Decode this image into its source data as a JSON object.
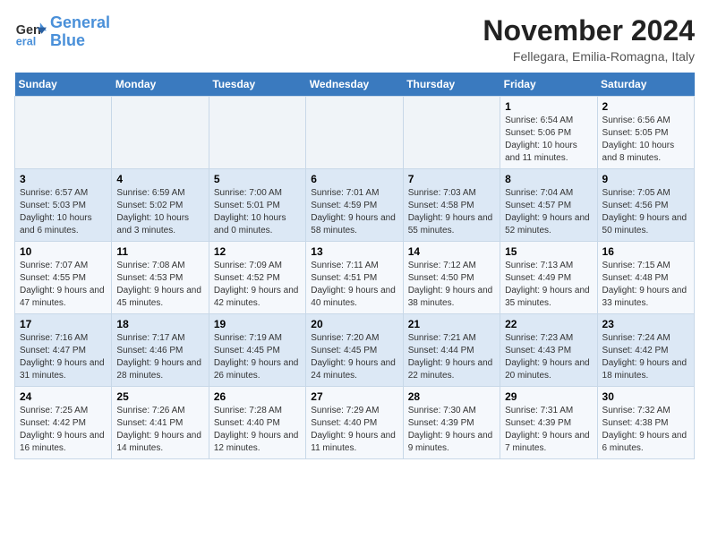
{
  "logo": {
    "line1": "General",
    "line2": "Blue"
  },
  "title": "November 2024",
  "location": "Fellegara, Emilia-Romagna, Italy",
  "weekdays": [
    "Sunday",
    "Monday",
    "Tuesday",
    "Wednesday",
    "Thursday",
    "Friday",
    "Saturday"
  ],
  "weeks": [
    [
      {
        "day": "",
        "info": ""
      },
      {
        "day": "",
        "info": ""
      },
      {
        "day": "",
        "info": ""
      },
      {
        "day": "",
        "info": ""
      },
      {
        "day": "",
        "info": ""
      },
      {
        "day": "1",
        "info": "Sunrise: 6:54 AM\nSunset: 5:06 PM\nDaylight: 10 hours and 11 minutes."
      },
      {
        "day": "2",
        "info": "Sunrise: 6:56 AM\nSunset: 5:05 PM\nDaylight: 10 hours and 8 minutes."
      }
    ],
    [
      {
        "day": "3",
        "info": "Sunrise: 6:57 AM\nSunset: 5:03 PM\nDaylight: 10 hours and 6 minutes."
      },
      {
        "day": "4",
        "info": "Sunrise: 6:59 AM\nSunset: 5:02 PM\nDaylight: 10 hours and 3 minutes."
      },
      {
        "day": "5",
        "info": "Sunrise: 7:00 AM\nSunset: 5:01 PM\nDaylight: 10 hours and 0 minutes."
      },
      {
        "day": "6",
        "info": "Sunrise: 7:01 AM\nSunset: 4:59 PM\nDaylight: 9 hours and 58 minutes."
      },
      {
        "day": "7",
        "info": "Sunrise: 7:03 AM\nSunset: 4:58 PM\nDaylight: 9 hours and 55 minutes."
      },
      {
        "day": "8",
        "info": "Sunrise: 7:04 AM\nSunset: 4:57 PM\nDaylight: 9 hours and 52 minutes."
      },
      {
        "day": "9",
        "info": "Sunrise: 7:05 AM\nSunset: 4:56 PM\nDaylight: 9 hours and 50 minutes."
      }
    ],
    [
      {
        "day": "10",
        "info": "Sunrise: 7:07 AM\nSunset: 4:55 PM\nDaylight: 9 hours and 47 minutes."
      },
      {
        "day": "11",
        "info": "Sunrise: 7:08 AM\nSunset: 4:53 PM\nDaylight: 9 hours and 45 minutes."
      },
      {
        "day": "12",
        "info": "Sunrise: 7:09 AM\nSunset: 4:52 PM\nDaylight: 9 hours and 42 minutes."
      },
      {
        "day": "13",
        "info": "Sunrise: 7:11 AM\nSunset: 4:51 PM\nDaylight: 9 hours and 40 minutes."
      },
      {
        "day": "14",
        "info": "Sunrise: 7:12 AM\nSunset: 4:50 PM\nDaylight: 9 hours and 38 minutes."
      },
      {
        "day": "15",
        "info": "Sunrise: 7:13 AM\nSunset: 4:49 PM\nDaylight: 9 hours and 35 minutes."
      },
      {
        "day": "16",
        "info": "Sunrise: 7:15 AM\nSunset: 4:48 PM\nDaylight: 9 hours and 33 minutes."
      }
    ],
    [
      {
        "day": "17",
        "info": "Sunrise: 7:16 AM\nSunset: 4:47 PM\nDaylight: 9 hours and 31 minutes."
      },
      {
        "day": "18",
        "info": "Sunrise: 7:17 AM\nSunset: 4:46 PM\nDaylight: 9 hours and 28 minutes."
      },
      {
        "day": "19",
        "info": "Sunrise: 7:19 AM\nSunset: 4:45 PM\nDaylight: 9 hours and 26 minutes."
      },
      {
        "day": "20",
        "info": "Sunrise: 7:20 AM\nSunset: 4:45 PM\nDaylight: 9 hours and 24 minutes."
      },
      {
        "day": "21",
        "info": "Sunrise: 7:21 AM\nSunset: 4:44 PM\nDaylight: 9 hours and 22 minutes."
      },
      {
        "day": "22",
        "info": "Sunrise: 7:23 AM\nSunset: 4:43 PM\nDaylight: 9 hours and 20 minutes."
      },
      {
        "day": "23",
        "info": "Sunrise: 7:24 AM\nSunset: 4:42 PM\nDaylight: 9 hours and 18 minutes."
      }
    ],
    [
      {
        "day": "24",
        "info": "Sunrise: 7:25 AM\nSunset: 4:42 PM\nDaylight: 9 hours and 16 minutes."
      },
      {
        "day": "25",
        "info": "Sunrise: 7:26 AM\nSunset: 4:41 PM\nDaylight: 9 hours and 14 minutes."
      },
      {
        "day": "26",
        "info": "Sunrise: 7:28 AM\nSunset: 4:40 PM\nDaylight: 9 hours and 12 minutes."
      },
      {
        "day": "27",
        "info": "Sunrise: 7:29 AM\nSunset: 4:40 PM\nDaylight: 9 hours and 11 minutes."
      },
      {
        "day": "28",
        "info": "Sunrise: 7:30 AM\nSunset: 4:39 PM\nDaylight: 9 hours and 9 minutes."
      },
      {
        "day": "29",
        "info": "Sunrise: 7:31 AM\nSunset: 4:39 PM\nDaylight: 9 hours and 7 minutes."
      },
      {
        "day": "30",
        "info": "Sunrise: 7:32 AM\nSunset: 4:38 PM\nDaylight: 9 hours and 6 minutes."
      }
    ]
  ]
}
